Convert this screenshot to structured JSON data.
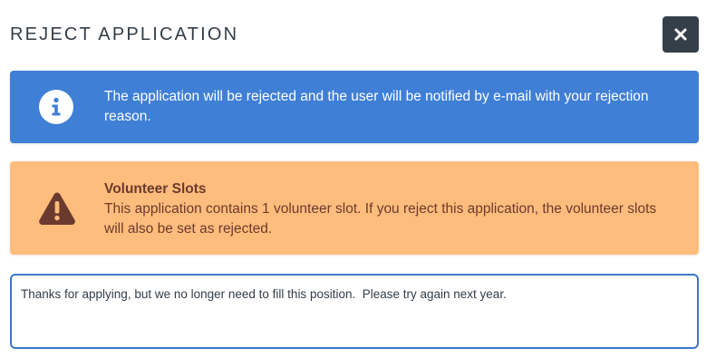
{
  "modal": {
    "title": "REJECT APPLICATION",
    "close_icon": "close-icon"
  },
  "info_alert": {
    "icon": "info-icon",
    "message": "The application will be rejected and the user will be notified by e-mail with your rejection reason.",
    "background": "#3f7fd6",
    "text_color": "#ffffff"
  },
  "warning_alert": {
    "icon": "warning-icon",
    "heading": "Volunteer Slots",
    "message": "This application contains 1 volunteer slot. If you reject this application, the volunteer slots will also be set as rejected.",
    "background": "#ffbd7d",
    "text_color": "#6b3a2e"
  },
  "rejection_reason": {
    "value": "Thanks for applying, but we no longer need to fill this position.  Please try again next year."
  }
}
